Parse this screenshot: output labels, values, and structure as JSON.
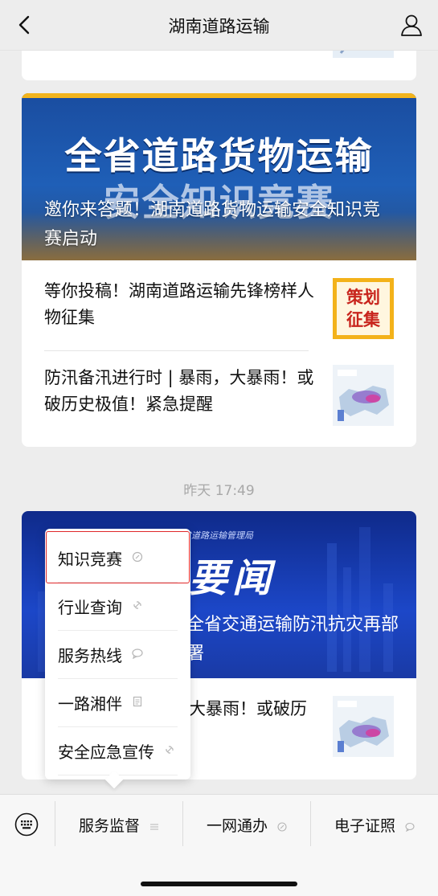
{
  "header": {
    "title": "湖南道路运输"
  },
  "feed": {
    "card1": {
      "banner_big_line1": "全省道路货物运输",
      "banner_big_line2": "安全知识竞赛",
      "banner_caption": "邀你来答题！湖南道路货物运输安全知识竞赛启动",
      "items": [
        {
          "title": "等你投稿！湖南道路运输先锋榜样人物征集",
          "thumb_text_1": "策划",
          "thumb_text_2": "征集"
        },
        {
          "title": "防汛备汛进行时 | 暴雨，大暴雨！或破历史极值！紧急提醒"
        }
      ]
    },
    "timestamp": "昨天 17:49",
    "card2": {
      "banner_org": "省道路运输管理局",
      "banner_big": "要闻",
      "banner_caption": "全省交通运输防汛抗灾再部署",
      "item_title": "大暴雨！或破历"
    }
  },
  "popup_menu": {
    "items": [
      {
        "label": "知识竞赛",
        "icon": "link-icon",
        "selected": true
      },
      {
        "label": "行业查询",
        "icon": "link-icon"
      },
      {
        "label": "服务热线",
        "icon": "chat-icon"
      },
      {
        "label": "一路湘伴",
        "icon": "doc-icon"
      },
      {
        "label": "安全应急宣传",
        "icon": "link-icon"
      }
    ]
  },
  "bottom_bar": {
    "tabs": [
      {
        "label": "服务监督",
        "icon": "menu-icon"
      },
      {
        "label": "一网通办",
        "icon": "link-icon"
      },
      {
        "label": "电子证照",
        "icon": "chat-icon"
      }
    ]
  },
  "colors": {
    "background": "#ededed",
    "selection_border": "#e0282a",
    "banner1_stripe": "#f2b41d",
    "banner2_blue": "#1c47c8"
  }
}
